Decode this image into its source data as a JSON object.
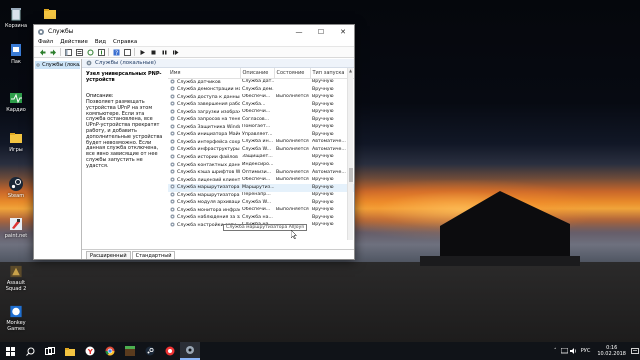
{
  "desktop": {
    "icons": [
      {
        "label": "Корзина",
        "icon": "recycle-bin-icon"
      },
      {
        "label": "",
        "icon": "folder-icon"
      },
      {
        "label": "Пак",
        "icon": "file-icon"
      },
      {
        "label": "Кардио",
        "icon": "app-icon"
      },
      {
        "label": "Игры",
        "icon": "folder-icon"
      },
      {
        "label": "Steam",
        "icon": "steam-icon"
      },
      {
        "label": "paint.net",
        "icon": "paint-icon"
      },
      {
        "label": "Assault Squad 2",
        "icon": "game-icon"
      },
      {
        "label": "Monkey Games",
        "icon": "monkey-icon"
      }
    ]
  },
  "window": {
    "title": "Службы",
    "menu": [
      "Файл",
      "Действие",
      "Вид",
      "Справка"
    ],
    "tree_item": "Службы (локальные)",
    "pane_header": "Службы (локальные)",
    "selected_service": "Узел универсальных PNP-устройств",
    "description_label": "Описание:",
    "description_text": "Позволяет размещать устройства UPnP на этом компьютере. Если эта служба остановлена, все UPnP-устройства прекратят работу, и добавить дополнительные устройства будет невозможно. Если данная служба отключена, все явно зависящие от нее службы запустить не удастся.",
    "columns": [
      "Имя",
      "Описание",
      "Состояние",
      "Тип запуска"
    ],
    "rows": [
      {
        "name": "Служба датчиков",
        "desc": "Служба дат...",
        "state": "",
        "start": "Вручную"
      },
      {
        "name": "Служба демонстрации маг...",
        "desc": "Служба дем...",
        "state": "",
        "start": "Вручную"
      },
      {
        "name": "Служба доступа к данным...",
        "desc": "Обеспечи...",
        "state": "Выполняется",
        "start": "Вручную"
      },
      {
        "name": "Служба завершения рабо...",
        "desc": "Служба...",
        "state": "",
        "start": "Вручную"
      },
      {
        "name": "Служба загрузки изображ...",
        "desc": "Обеспечи...",
        "state": "",
        "start": "Вручную"
      },
      {
        "name": "Служба запросов на теневое...",
        "desc": "Согласов...",
        "state": "",
        "start": "Вручную"
      },
      {
        "name": "Служба Защитника Windo...",
        "desc": "Помогает...",
        "state": "",
        "start": "Вручную"
      },
      {
        "name": "Служба инициатора Майк...",
        "desc": "Управляет...",
        "state": "",
        "start": "Вручную"
      },
      {
        "name": "Служба интерфейса сохра...",
        "desc": "Служба ин...",
        "state": "Выполняется",
        "start": "Автоматиче..."
      },
      {
        "name": "Служба инфраструктуры ф...",
        "desc": "Служба W...",
        "state": "Выполняется",
        "start": "Автоматиче..."
      },
      {
        "name": "Служба истории файлов",
        "desc": "Защищает...",
        "state": "",
        "start": "Вручную"
      },
      {
        "name": "Служба контактных данных...",
        "desc": "Индексиро...",
        "state": "",
        "start": "Вручную"
      },
      {
        "name": "Служба кэша шрифтов Wi...",
        "desc": "Оптимизи...",
        "state": "Выполняется",
        "start": "Автоматиче..."
      },
      {
        "name": "Служба лицензий клиента...",
        "desc": "Обеспечи...",
        "state": "Выполняется",
        "start": "Вручную"
      },
      {
        "name": "Служба маршрутизатора AllJoyn",
        "desc": "Маршрутиз...",
        "state": "",
        "start": "Вручную"
      },
      {
        "name": "Служба маршрутизатора S...",
        "desc": "Перенапр...",
        "state": "",
        "start": "Вручную"
      },
      {
        "name": "Служба модуля архивации...",
        "desc": "Служба W...",
        "state": "",
        "start": "Вручную"
      },
      {
        "name": "Служба монитора инфраст...",
        "desc": "Обеспечи...",
        "state": "Выполняется",
        "start": "Вручную"
      },
      {
        "name": "Служба наблюдения за за...",
        "desc": "Служба на...",
        "state": "",
        "start": "Вручную"
      },
      {
        "name": "Служба настройки сети",
        "desc": "Служба на...",
        "state": "",
        "start": "Вручную"
      }
    ],
    "tooltip": "Служба маршрутизатора AllJoyn",
    "tabs": [
      "Расширенный",
      "Стандартный"
    ]
  },
  "taskbar": {
    "apps": [
      "start-icon",
      "search-icon",
      "task-view-icon",
      "file-explorer-icon",
      "yandex-icon",
      "chrome-icon",
      "minecraft-icon",
      "steam-icon",
      "obs-icon",
      "services-icon"
    ],
    "tray_lang": "РУС",
    "time": "0:16",
    "date": "10.02.2018"
  }
}
